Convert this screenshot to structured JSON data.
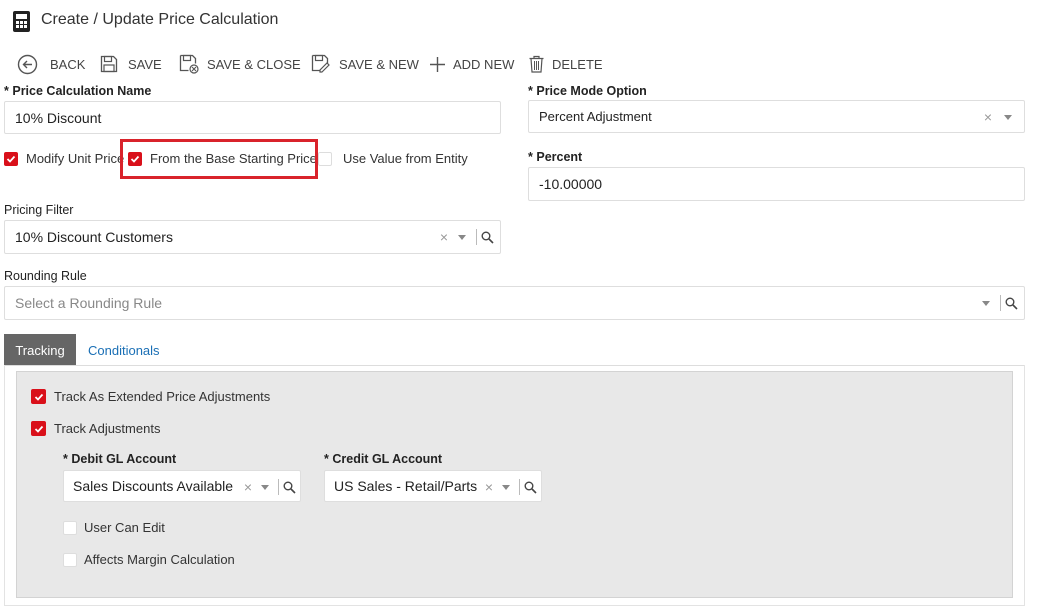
{
  "header": {
    "title": "Create / Update Price Calculation"
  },
  "toolbar": {
    "back": "BACK",
    "save": "SAVE",
    "save_close": "SAVE & CLOSE",
    "save_new": "SAVE & NEW",
    "add_new": "ADD NEW",
    "delete": "DELETE"
  },
  "form": {
    "name_label": "Price Calculation Name",
    "name_value": "10% Discount",
    "mode_label": "Price Mode Option",
    "mode_value": "Percent Adjustment",
    "modify_unit_price": "Modify Unit Price",
    "from_base": "From the Base Starting Price",
    "use_value_entity": "Use Value from Entity",
    "percent_label": "Percent",
    "percent_value": "-10.00000",
    "pricing_filter_label": "Pricing Filter",
    "pricing_filter_value": "10% Discount Customers",
    "rounding_label": "Rounding Rule",
    "rounding_placeholder": "Select a Rounding Rule",
    "required_mark": "*"
  },
  "tabs": {
    "tracking": "Tracking",
    "conditionals": "Conditionals"
  },
  "tracking": {
    "extended": "Track As Extended Price Adjustments",
    "adjustments": "Track Adjustments",
    "debit_label": "Debit GL Account",
    "debit_value": "Sales Discounts Available",
    "credit_label": "Credit GL Account",
    "credit_value": "US Sales - Retail/Parts",
    "user_can_edit": "User Can Edit",
    "affects_margin": "Affects Margin Calculation"
  },
  "colors": {
    "accent": "#d9101a",
    "link": "#1a6fb5",
    "highlight": "#d9232b"
  }
}
